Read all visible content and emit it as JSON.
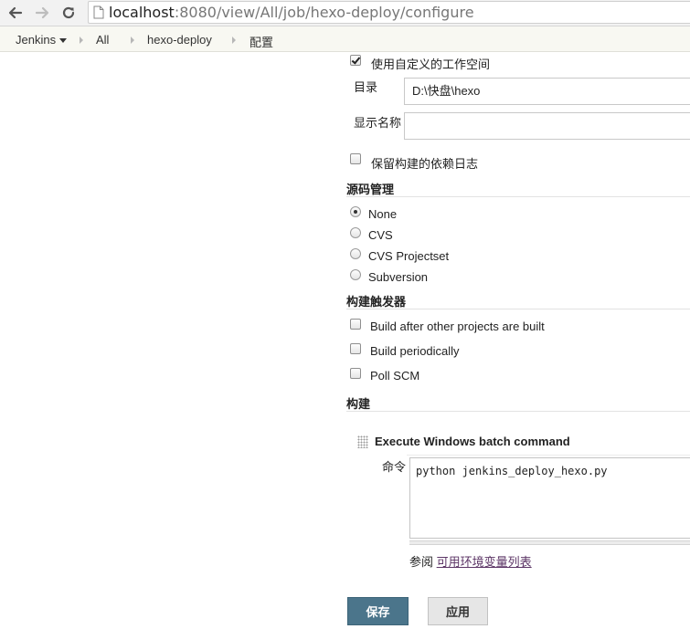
{
  "browser": {
    "url_host": "localhost",
    "url_rest": ":8080/view/All/job/hexo-deploy/configure",
    "icons": [
      "back-arrow-icon",
      "forward-arrow-icon",
      "reload-icon",
      "page-icon"
    ]
  },
  "breadcrumb": {
    "items": [
      "Jenkins",
      "All",
      "hexo-deploy",
      "配置"
    ]
  },
  "general": {
    "custom_workspace_label": "使用自定义的工作空间",
    "custom_workspace_checked": true,
    "directory_label": "目录",
    "directory_value": "D:\\快盘\\hexo",
    "display_name_label": "显示名称",
    "display_name_value": "",
    "keep_deps_label": "保留构建的依赖日志",
    "keep_deps_checked": false
  },
  "scm": {
    "title": "源码管理",
    "options": [
      "None",
      "CVS",
      "CVS Projectset",
      "Subversion"
    ],
    "selected": "None"
  },
  "triggers": {
    "title": "构建触发器",
    "options": [
      "Build after other projects are built",
      "Build periodically",
      "Poll SCM"
    ]
  },
  "build": {
    "title": "构建",
    "step_title": "Execute Windows batch command",
    "command_label": "命令",
    "command_value": "python jenkins_deploy_hexo.py",
    "help_prefix": "参阅",
    "help_link": "可用环境变量列表"
  },
  "actions": {
    "save_label": "保存",
    "apply_label": "应用"
  },
  "colors": {
    "primary_button": "#4b758b",
    "breadcrumb_bg": "#f8f8f2",
    "link": "#5c3566"
  }
}
